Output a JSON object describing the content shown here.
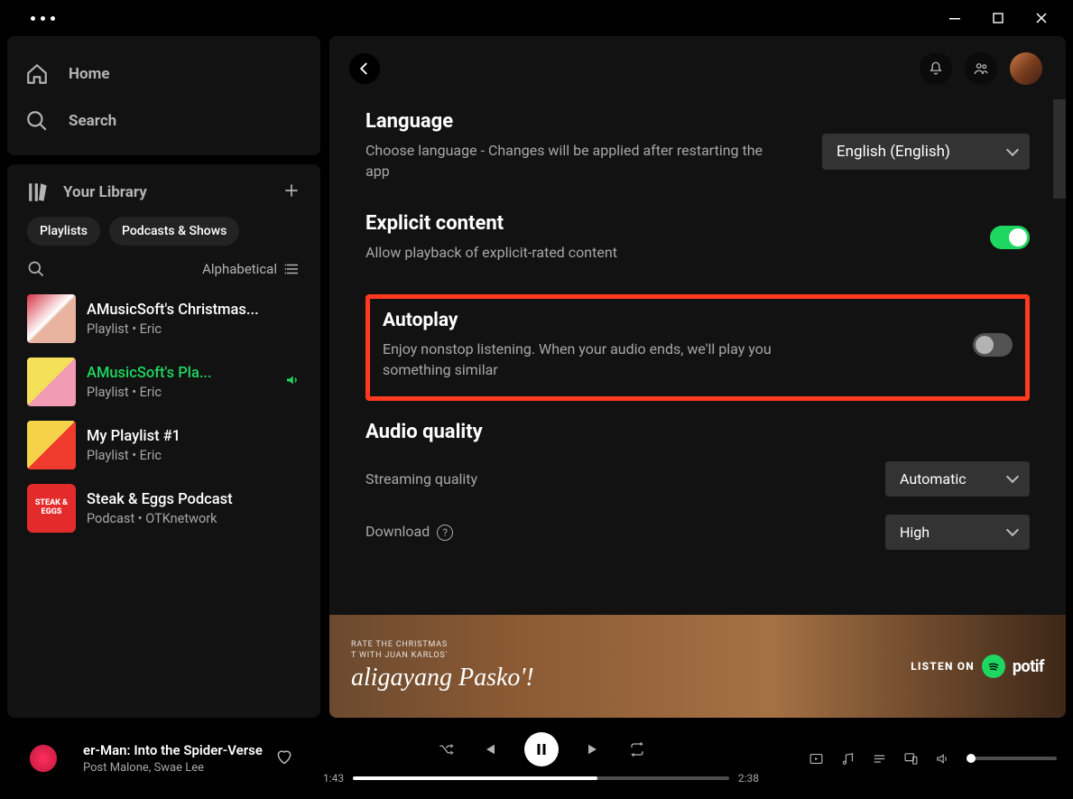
{
  "window": {
    "minimize": "–",
    "maximize": "▢",
    "close": "✕"
  },
  "nav": {
    "home": "Home",
    "search": "Search"
  },
  "library": {
    "title": "Your Library",
    "chips": [
      "Playlists",
      "Podcasts & Shows"
    ],
    "sort": "Alphabetical",
    "items": [
      {
        "title": "AMusicSoft's Christmas...",
        "sub": "Playlist • Eric",
        "thumb": "th0"
      },
      {
        "title": "AMusicSoft's Pla...",
        "sub": "Playlist • Eric",
        "thumb": "th1",
        "active": true
      },
      {
        "title": "My Playlist #1",
        "sub": "Playlist • Eric",
        "thumb": "th2"
      },
      {
        "title": "Steak & Eggs Podcast",
        "sub": "Podcast • OTKnetwork",
        "thumb": "th3",
        "thumbText": "STEAK & EGGS"
      }
    ]
  },
  "settings": {
    "language": {
      "title": "Language",
      "desc": "Choose language - Changes will be applied after restarting the app",
      "value": "English (English)"
    },
    "explicit": {
      "title": "Explicit content",
      "desc": "Allow playback of explicit-rated content",
      "enabled": true
    },
    "autoplay": {
      "title": "Autoplay",
      "desc": "Enjoy nonstop listening. When your audio ends, we'll play you something similar",
      "enabled": false
    },
    "audio": {
      "title": "Audio quality",
      "streaming_label": "Streaming quality",
      "streaming_value": "Automatic",
      "download_label": "Download",
      "download_value": "High"
    }
  },
  "banner": {
    "pre1": "RATE THE CHRISTMAS",
    "pre2": "T WITH JUAN KARLOS'",
    "big": "aligayang Pasko'!",
    "listen": "LISTEN ON",
    "brand": "potif"
  },
  "player": {
    "track": "er-Man: Into the Spider-Verse",
    "artist": "Post Malone, Swae Lee",
    "elapsed": "1:43",
    "total": "2:38",
    "progress_pct": 65
  }
}
